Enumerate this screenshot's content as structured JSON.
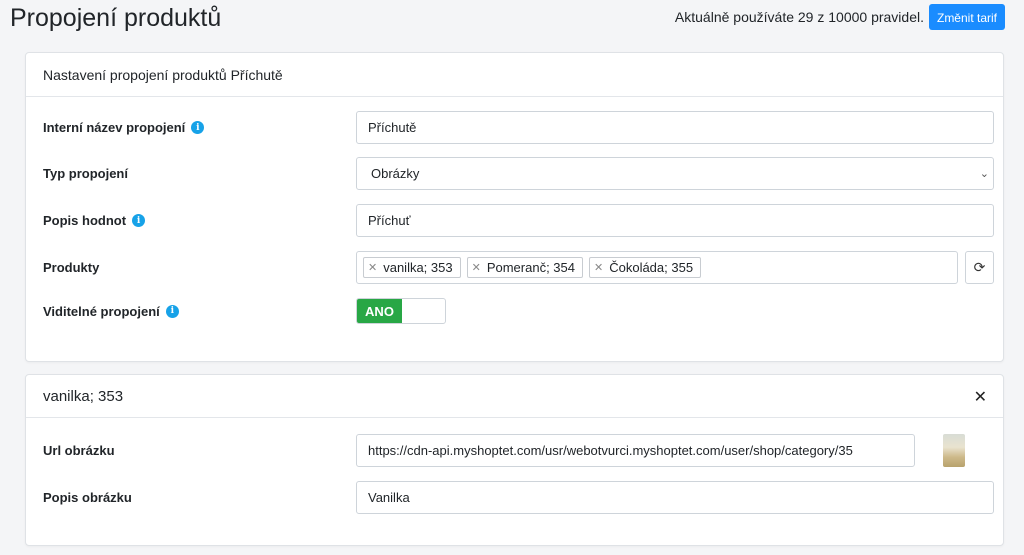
{
  "header": {
    "title": "Propojení produktů",
    "usage_text": "Aktuálně používáte 29 z 10000 pravidel.",
    "change_plan_label": "Změnit tarif"
  },
  "settings_card": {
    "title": "Nastavení propojení produktů Příchutě",
    "fields": {
      "internal_name_label": "Interní název propojení",
      "internal_name_value": "Příchutě",
      "type_label": "Typ propojení",
      "type_value": "Obrázky",
      "values_desc_label": "Popis hodnot",
      "values_desc_value": "Příchuť",
      "products_label": "Produkty",
      "products": [
        "vanilka; 353",
        "Pomeranč; 354",
        "Čokoláda; 355"
      ],
      "visible_label": "Viditelné propojení",
      "visible_value": "ANO"
    }
  },
  "item_card": {
    "title": "vanilka; 353",
    "url_label": "Url obrázku",
    "url_value": "https://cdn-api.myshoptet.com/usr/webotvurci.myshoptet.com/user/shop/category/35",
    "desc_label": "Popis obrázku",
    "desc_value": "Vanilka"
  },
  "colors": {
    "primary": "#1a8cff",
    "success": "#28a745",
    "info": "#17a2e8"
  }
}
